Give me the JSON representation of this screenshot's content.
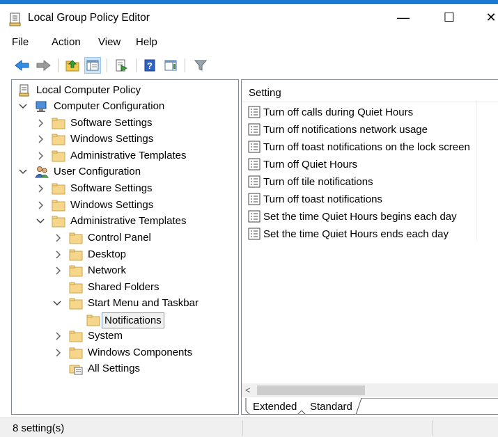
{
  "window": {
    "title": "Local Group Policy Editor",
    "min_glyph": "—",
    "max_glyph": "☐",
    "close_glyph": "✕"
  },
  "menu": {
    "items": [
      "File",
      "Action",
      "View",
      "Help"
    ]
  },
  "toolbar": {
    "buttons": [
      "back-icon",
      "forward-icon",
      "up-folder-icon",
      "show-hide-tree-icon",
      "export-list-icon",
      "help-icon",
      "show-hide-action-pane-icon",
      "filter-icon"
    ]
  },
  "tree": {
    "root": "Local Computer Policy",
    "computer_config": "Computer Configuration",
    "cc_software": "Software Settings",
    "cc_windows": "Windows Settings",
    "cc_admin": "Administrative Templates",
    "user_config": "User Configuration",
    "uc_software": "Software Settings",
    "uc_windows": "Windows Settings",
    "uc_admin": "Administrative Templates",
    "control_panel": "Control Panel",
    "desktop": "Desktop",
    "network": "Network",
    "shared_folders": "Shared Folders",
    "start_menu": "Start Menu and Taskbar",
    "notifications": "Notifications",
    "system": "System",
    "windows_components": "Windows Components",
    "all_settings": "All Settings"
  },
  "list": {
    "column_header": "Setting",
    "items": [
      "Turn off calls during Quiet Hours",
      "Turn off notifications network usage",
      "Turn off toast notifications on the lock screen",
      "Turn off Quiet Hours",
      "Turn off tile notifications",
      "Turn off toast notifications",
      "Set the time Quiet Hours begins each day",
      "Set the time Quiet Hours ends each day"
    ],
    "scroll_left_glyph": "<"
  },
  "tabs": {
    "extended": "Extended",
    "standard": "Standard",
    "active": "Standard"
  },
  "status": {
    "text": "8 setting(s)"
  },
  "colors": {
    "accent": "#1c78d0",
    "selection_bg": "#cce4f7",
    "folder": "#f5d68a",
    "border": "#828790"
  }
}
